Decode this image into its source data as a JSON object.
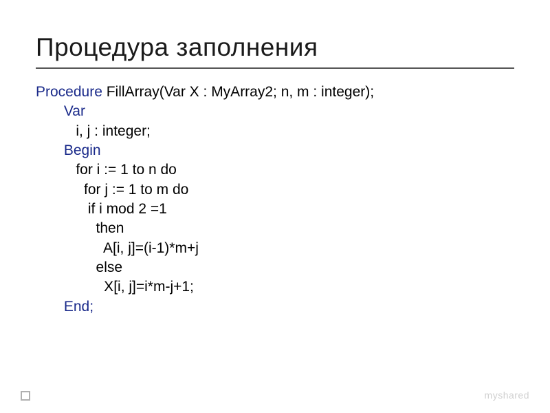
{
  "title": "Процедура заполнения",
  "code": {
    "l1_kw": "Procedure ",
    "l1_rest": "FillArray(Var X : MyArray2; n, m : integer);",
    "l2_kw": "       Var",
    "l3": "          i, j : integer;",
    "l4_kw": "       Begin",
    "l5": "          for i := 1 to n do",
    "l6": "            for j := 1 to m do",
    "l7": "             if i mod 2 =1",
    "l8": "               then",
    "l9": "                 A[i, j]=(i-1)*m+j",
    "l10": "               else",
    "l11": "                 X[i, j]=i*m-j+1;",
    "l12_kw": "       End;"
  },
  "footer": {
    "brand": "myshared"
  }
}
